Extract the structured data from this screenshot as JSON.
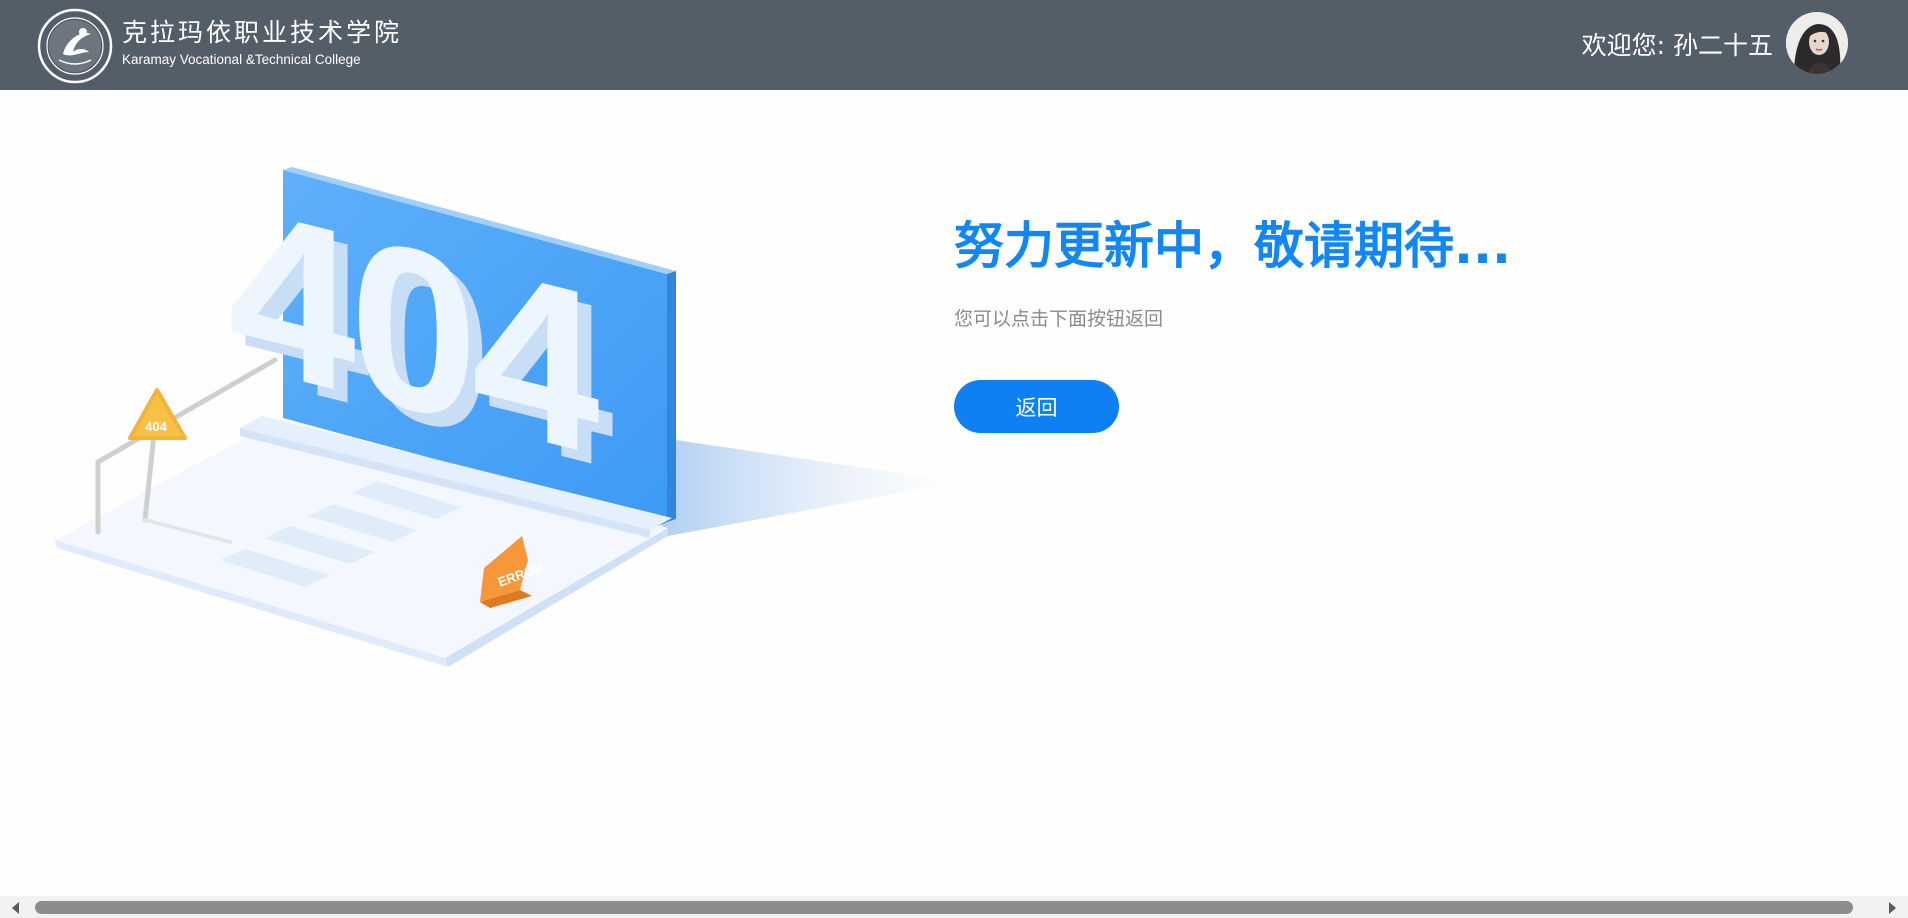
{
  "header": {
    "college_name_cn": "克拉玛依职业技术学院",
    "college_name_en": "Karamay Vocational &Technical College",
    "welcome_text": "欢迎您: 孙二十五",
    "avatar_icon": "user-avatar",
    "logo_icon": "college-seal-logo"
  },
  "main": {
    "title": "努力更新中，敬请期待...",
    "subtitle": "您可以点击下面按钮返回",
    "back_button_label": "返回"
  },
  "illustration": {
    "big_text": "404",
    "sign_text": "404",
    "error_text": "ERROR"
  },
  "colors": {
    "header_bg": "#545e69",
    "accent": "#1187f5",
    "button": "#0e80f3",
    "page_bg": "#fefefc"
  }
}
